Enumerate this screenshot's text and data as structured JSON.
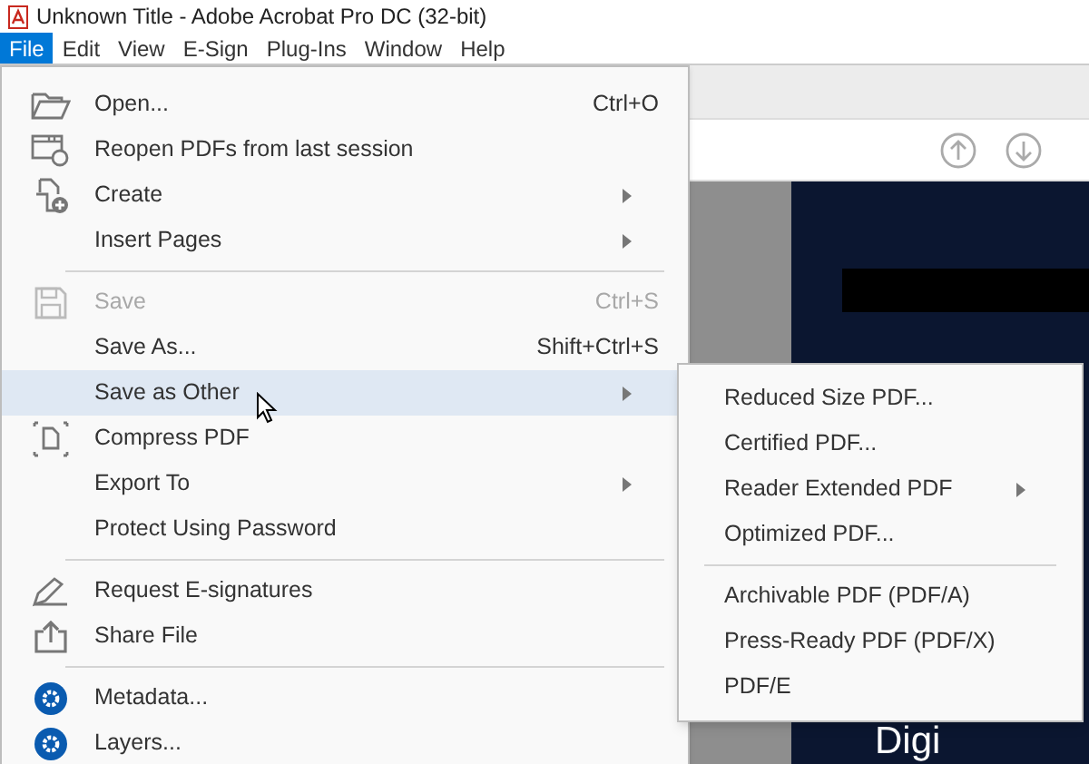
{
  "window": {
    "title": "Unknown Title - Adobe Acrobat Pro DC (32-bit)"
  },
  "menu_bar": [
    {
      "label": "File",
      "selected": true
    },
    {
      "label": "Edit",
      "selected": false
    },
    {
      "label": "View",
      "selected": false
    },
    {
      "label": "E-Sign",
      "selected": false
    },
    {
      "label": "Plug-Ins",
      "selected": false
    },
    {
      "label": "Window",
      "selected": false
    },
    {
      "label": "Help",
      "selected": false
    }
  ],
  "document": {
    "heading": "Digi"
  },
  "file_menu": [
    {
      "kind": "item",
      "label": "Open...",
      "shortcut": "Ctrl+O",
      "disabled": false,
      "selected": false,
      "submenu": false
    },
    {
      "kind": "item",
      "label": "Reopen PDFs from last session",
      "disabled": false,
      "selected": false,
      "submenu": false
    },
    {
      "kind": "item",
      "label": "Create",
      "disabled": false,
      "selected": false,
      "submenu": true
    },
    {
      "kind": "item",
      "label": "Insert Pages",
      "disabled": false,
      "selected": false,
      "submenu": true
    },
    {
      "kind": "separator"
    },
    {
      "kind": "item",
      "label": "Save",
      "shortcut": "Ctrl+S",
      "disabled": true,
      "selected": false,
      "submenu": false
    },
    {
      "kind": "item",
      "label": "Save As...",
      "shortcut": "Shift+Ctrl+S",
      "disabled": false,
      "selected": false,
      "submenu": false
    },
    {
      "kind": "item",
      "label": "Save as Other",
      "disabled": false,
      "selected": true,
      "submenu": true
    },
    {
      "kind": "item",
      "label": "Compress PDF",
      "disabled": false,
      "selected": false,
      "submenu": false
    },
    {
      "kind": "item",
      "label": "Export To",
      "disabled": false,
      "selected": false,
      "submenu": true
    },
    {
      "kind": "item",
      "label": "Protect Using Password",
      "disabled": false,
      "selected": false,
      "submenu": false
    },
    {
      "kind": "separator"
    },
    {
      "kind": "item",
      "label": "Request E-signatures",
      "disabled": false,
      "selected": false,
      "submenu": false
    },
    {
      "kind": "item",
      "label": "Share File",
      "disabled": false,
      "selected": false,
      "submenu": false
    },
    {
      "kind": "separator"
    },
    {
      "kind": "item",
      "label": "Metadata...",
      "disabled": false,
      "selected": false,
      "submenu": false
    },
    {
      "kind": "item",
      "label": "Layers...",
      "disabled": false,
      "selected": false,
      "submenu": false
    }
  ],
  "save_as_other_menu": [
    {
      "kind": "item",
      "label": "Reduced Size PDF...",
      "submenu": false
    },
    {
      "kind": "item",
      "label": "Certified PDF...",
      "submenu": false
    },
    {
      "kind": "item",
      "label": "Reader Extended PDF",
      "submenu": true
    },
    {
      "kind": "item",
      "label": "Optimized PDF...",
      "submenu": false
    },
    {
      "kind": "separator"
    },
    {
      "kind": "item",
      "label": "Archivable PDF (PDF/A)",
      "submenu": false
    },
    {
      "kind": "item",
      "label": "Press-Ready PDF (PDF/X)",
      "submenu": false
    },
    {
      "kind": "item",
      "label": "PDF/E",
      "submenu": false
    }
  ]
}
